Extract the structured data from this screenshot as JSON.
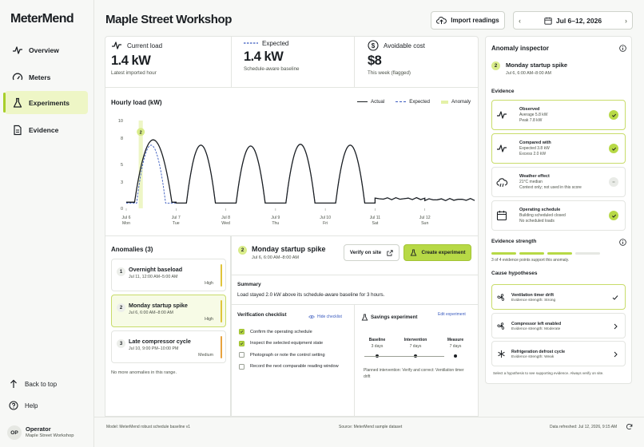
{
  "app": {
    "logo": "MeterMend",
    "page_title": "Maple Street Workshop"
  },
  "sidebar": {
    "items": [
      {
        "label": "Overview",
        "icon": "pulse-icon"
      },
      {
        "label": "Meters",
        "icon": "gauge-icon"
      },
      {
        "label": "Experiments",
        "icon": "flask-icon",
        "active": true
      },
      {
        "label": "Evidence",
        "icon": "document-icon"
      }
    ],
    "back_to_top": "Back to top",
    "help": "Help",
    "user": {
      "initials": "OP",
      "name": "Operator",
      "org": "Maple Street Workshop"
    }
  },
  "header": {
    "import_label": "Import readings",
    "date_range": "Jul 6–12, 2026"
  },
  "kpis": [
    {
      "label": "Current load",
      "value": "1.4 kW",
      "sub": "Latest imported hour",
      "icon": "pulse-icon"
    },
    {
      "label": "Expected",
      "value": "1.4 kW",
      "sub": "Schedule-aware baseline",
      "icon": "dashed-line-icon"
    },
    {
      "label": "Avoidable cost",
      "value": "$8",
      "sub": "This week (flagged)",
      "icon": "dollar-icon"
    }
  ],
  "chart": {
    "title": "Hourly load (kW)",
    "legend": {
      "actual": "Actual",
      "expected": "Expected",
      "anomaly": "Anomaly"
    }
  },
  "chart_data": {
    "type": "line",
    "title": "Hourly load (kW)",
    "ylim": [
      0,
      10
    ],
    "yticks": [
      0,
      3,
      5,
      8,
      10
    ],
    "x_ticks": [
      {
        "date": "Jul 6",
        "day": "Mon"
      },
      {
        "date": "Jul 7",
        "day": "Tue"
      },
      {
        "date": "Jul 8",
        "day": "Wed"
      },
      {
        "date": "Jul 9",
        "day": "Thu"
      },
      {
        "date": "Jul 10",
        "day": "Fri"
      },
      {
        "date": "Jul 11",
        "day": "Sat"
      },
      {
        "date": "Jul 12",
        "day": "Sun"
      }
    ],
    "series": [
      {
        "name": "Actual",
        "days": [
          {
            "base": 0.7,
            "peak": 7.8,
            "rise": 5,
            "fall": 21
          },
          {
            "base": 0.6,
            "peak": 7.2,
            "rise": 6,
            "fall": 18
          },
          {
            "base": 0.6,
            "peak": 7.1,
            "rise": 6,
            "fall": 18
          },
          {
            "base": 0.6,
            "peak": 7.3,
            "rise": 6,
            "fall": 18
          },
          {
            "base": 0.6,
            "peak": 7.2,
            "rise": 6,
            "fall": 18
          },
          {
            "base": 1.1,
            "peak": 1.3,
            "rise": 0,
            "fall": 24
          },
          {
            "base": 1.0,
            "peak": 1.3,
            "rise": 0,
            "fall": 24
          }
        ]
      },
      {
        "name": "Expected",
        "days": [
          {
            "base": 0.6,
            "peak": 7.2,
            "rise": 6,
            "fall": 18
          },
          {
            "base": 0.6,
            "peak": 7.2,
            "rise": 6,
            "fall": 18
          },
          {
            "base": 0.6,
            "peak": 7.1,
            "rise": 6,
            "fall": 18
          },
          {
            "base": 0.6,
            "peak": 7.3,
            "rise": 6,
            "fall": 18
          },
          {
            "base": 0.6,
            "peak": 7.2,
            "rise": 6,
            "fall": 18
          },
          {
            "base": 1.1,
            "peak": 1.1,
            "rise": 0,
            "fall": 24
          },
          {
            "base": 1.0,
            "peak": 1.0,
            "rise": 0,
            "fall": 24
          }
        ]
      }
    ],
    "anomaly_band": {
      "from": "Jul 6, 06:00",
      "to": "Jul 6, 08:00",
      "marker": "2",
      "marker_value": 8.7
    }
  },
  "anomalies": {
    "title": "Anomalies (3)",
    "items": [
      {
        "num": "1",
        "title": "Overnight baseload",
        "date": "Jul 11, 12:00 AM–5:00 AM",
        "level": "High",
        "bar": "#e0c43a"
      },
      {
        "num": "2",
        "title": "Monday startup spike",
        "date": "Jul 6, 6:00 AM–8:00 AM",
        "level": "High",
        "bar": "#e0c43a",
        "selected": true
      },
      {
        "num": "3",
        "title": "Late compressor cycle",
        "date": "Jul 10, 9:00 PM–10:00 PM",
        "level": "Medium",
        "bar": "#e8a23d"
      }
    ],
    "footer": "No more anomalies in this range."
  },
  "detail": {
    "num": "2",
    "title": "Monday startup spike",
    "date": "Jul 6, 6:00 AM–8:00 AM",
    "verify_label": "Verify on site",
    "create_label": "Create experiment",
    "summary_title": "Summary",
    "summary": "Load stayed 2.0 kW above its schedule-aware baseline for 3 hours.",
    "checklist_title": "Verification checklist",
    "hide_label": "Hide checklist",
    "checklist": [
      {
        "label": "Confirm the operating schedule",
        "checked": true
      },
      {
        "label": "Inspect the selected equipment state",
        "checked": true
      },
      {
        "label": "Photograph or note the control setting",
        "checked": false
      },
      {
        "label": "Record the next comparable reading window",
        "checked": false
      }
    ],
    "savings_title": "Savings experiment",
    "edit_label": "Edit experiment",
    "phases": [
      {
        "name": "Baseline",
        "dur": "3 days"
      },
      {
        "name": "Intervention",
        "dur": "7 days"
      },
      {
        "name": "Measure",
        "dur": "7 days"
      }
    ],
    "planned": "Planned intervention: Verify and correct: Ventilation timer drift"
  },
  "inspector": {
    "title": "Anomaly inspector",
    "num": "2",
    "name": "Monday startup spike",
    "date": "Jul 6, 6:00 AM–8:00 AM",
    "evidence_title": "Evidence",
    "evidence": [
      {
        "title": "Observed",
        "l1": "Average 5.8 kW",
        "l2": "Peak 7.8 kW",
        "icon": "pulse-icon",
        "state": "ok"
      },
      {
        "title": "Compared with",
        "l1": "Expected 3.8 kW",
        "l2": "Excess 2.0 kW",
        "icon": "pulse-icon",
        "state": "ok"
      },
      {
        "title": "Weather effect",
        "l1": "21°C median",
        "l2": "Context only; not used in this score",
        "icon": "cloud-icon",
        "state": "neutral"
      },
      {
        "title": "Operating schedule",
        "l1": "Building scheduled closed",
        "l2": "No scheduled loads",
        "icon": "calendar-icon",
        "state": "ok"
      }
    ],
    "strength_title": "Evidence strength",
    "strength_text": "3 of 4 evidence points support this anomaly.",
    "strength_filled": 3,
    "strength_total": 4,
    "hyp_title": "Cause hypotheses",
    "hypotheses": [
      {
        "title": "Ventilation timer drift",
        "strength": "Evidence strength: Strong",
        "icon": "fan-icon",
        "selected": true
      },
      {
        "title": "Compressor left enabled",
        "strength": "Evidence strength: Moderate",
        "icon": "fan-icon"
      },
      {
        "title": "Refrigeration defrost cycle",
        "strength": "Evidence strength: Weak",
        "icon": "snowflake-icon"
      }
    ],
    "footer": "Select a hypothesis to see supporting evidence. Always verify on site."
  },
  "footer": {
    "model": "Model: MeterMend robust schedule baseline v1",
    "source": "Source: MeterMend sample dataset",
    "refreshed": "Data refreshed: Jul 12, 2026, 9:15 AM"
  },
  "colors": {
    "accent": "#b7d946",
    "accent_soft": "#eef6c6",
    "ink": "#1b1f23",
    "expected": "#3a5bbf"
  }
}
